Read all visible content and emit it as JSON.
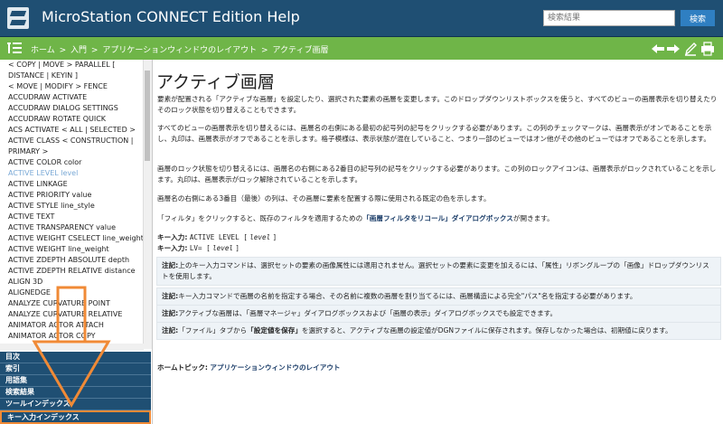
{
  "header": {
    "app_title": "MicroStation CONNECT Edition Help",
    "search_placeholder": "検索結果",
    "search_button": "検索"
  },
  "breadcrumb": {
    "items": [
      "ホーム",
      "入門",
      "アプリケーションウィンドウのレイアウト",
      "アクティブ画層"
    ],
    "separator": ">"
  },
  "sidebar": {
    "index_items": [
      "< COPY | MOVE > PARALLEL [",
      "DISTANCE | KEYIN ]",
      "< MOVE | MODIFY > FENCE",
      "ACCUDRAW ACTIVATE",
      "ACCUDRAW DIALOG SETTINGS",
      "ACCUDRAW ROTATE QUICK",
      "ACS ACTIVATE < ALL | SELECTED >",
      "ACTIVE CLASS < CONSTRUCTION |",
      "PRIMARY >",
      "ACTIVE COLOR color",
      "ACTIVE LEVEL level",
      "ACTIVE LINKAGE",
      "ACTIVE PRIORITY value",
      "ACTIVE STYLE line_style",
      "ACTIVE TEXT",
      "ACTIVE TRANSPARENCY value",
      "ACTIVE WEIGHT CSELECT line_weight",
      "ACTIVE WEIGHT line_weight",
      "ACTIVE ZDEPTH ABSOLUTE depth",
      "ACTIVE ZDEPTH RELATIVE distance",
      "ALIGN 3D",
      "ALIGNEDGE",
      "ANALYZE CURVATURE POINT",
      "ANALYZE CURVATURE RELATIVE",
      "ANIMATOR ACTOR ATTACH",
      "ANIMATOR ACTOR COPY"
    ],
    "active_index": 10,
    "nav_tabs": [
      "目次",
      "索引",
      "用語集",
      "検索結果",
      "ツールインデックス",
      "キー入力インデックス"
    ],
    "selected_tab": 5
  },
  "content": {
    "title": "アクティブ画層",
    "p1": "要素が配置される「アクティブな画層」を設定したり、選択された要素の画層を変更します。このドロップダウンリストボックスを使うと、すべてのビューの画層表示を切り替えたりそのロック状態を切り替えることもできます。",
    "p2": "すべてのビューの画層表示を切り替えるには、画層名の右側にある最初の記号列の記号をクリックする必要があります。この列のチェックマークは、画層表示がオンであることを示し、丸印は、画層表示がオフであることを示します。格子模様は、表示状態が混在していること、つまり一部のビューではオン他がその他のビューではオフであることを示します。",
    "p3": "画層のロック状態を切り替えるには、画層名の右側にある2番目の記号列の記号をクリックする必要があります。この列のロックアイコンは、画層表示がロックされていることを示します。丸印は、画層表示がロック解除されていることを示します。",
    "p4": "画層名の右側にある3番目（最後）の列は、その画層に要素を配置する際に使用される既定の色を示します。",
    "p5_pre": "「フィルタ」をクリックすると、既存のフィルタを適用するための",
    "p5_link": "「画層フィルタをリコール」ダイアログボックス",
    "p5_post": "が開きます。",
    "keyin_label": "キー入力:",
    "keyin1_cmd": "ACTIVE LEVEL [",
    "keyin1_arg": "level",
    "keyin1_end": "]",
    "keyin2_cmd": "LV= [",
    "keyin2_arg": "level",
    "keyin2_end": "]",
    "note_label": "注記:",
    "note1": "上のキー入力コマンドは、選択セットの要素の画像属性には適用されません。選択セットの要素に変更を加えるには、「属性」リボングループの「画像」ドロップダウンリストを使用します。",
    "note2": "キー入力コマンドで画層の名前を指定する場合、その名前に複数の画層を割り当てるには、画層構造による完全\"パス\"名を指定する必要があります。",
    "note3": "アクティブな画層は、「画層マネージャ」ダイアログボックスおよび「画層の表示」ダイアログボックスでも設定できます。",
    "note4_pre": "「ファイル」タブから",
    "note4_bold": "「設定値を保存」",
    "note4_post": "を選択すると、アクティブな画層の設定値がDGNファイルに保存されます。保存しなかった場合は、初期値に戻ります。",
    "home_topic_label": "ホームトピック:",
    "home_topic_link": "アプリケーションウィンドウのレイアウト"
  },
  "colors": {
    "header_bg": "#1f4f73",
    "breadcrumb_bg": "#6fb548",
    "annotation": "#f08a36"
  }
}
